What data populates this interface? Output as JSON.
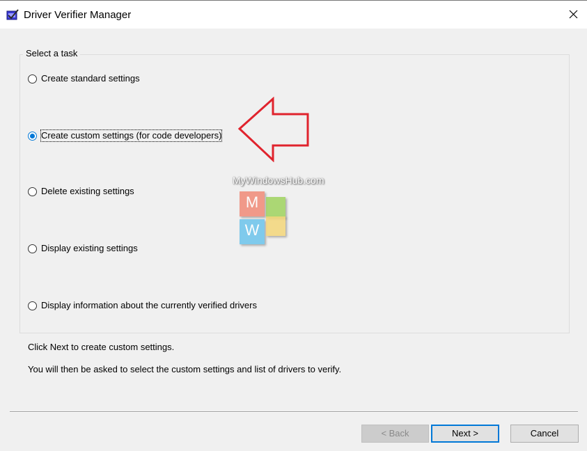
{
  "window": {
    "title": "Driver Verifier Manager"
  },
  "groupbox": {
    "title": "Select a task"
  },
  "options": [
    {
      "label": "Create standard settings",
      "checked": false
    },
    {
      "label": "Create custom settings (for code developers)",
      "checked": true
    },
    {
      "label": "Delete existing settings",
      "checked": false
    },
    {
      "label": "Display existing settings",
      "checked": false
    },
    {
      "label": "Display information about the currently verified drivers",
      "checked": false
    }
  ],
  "info": {
    "line1": "Click Next to create custom settings.",
    "line2": "You will then be asked to select the custom settings and list of drivers to verify."
  },
  "buttons": {
    "back": "< Back",
    "next": "Next >",
    "cancel": "Cancel"
  },
  "watermark": {
    "text": "MyWindowsHub.com",
    "tile_m": "M",
    "tile_w": "W"
  },
  "colors": {
    "accent": "#0078d7",
    "annotation_arrow": "#e0232d",
    "tile_m": "#f08a78",
    "tile_green": "#9fd35f",
    "tile_w": "#6cc4ec",
    "tile_yellow": "#f4d77a"
  },
  "icons": {
    "app": "driver-verifier-icon",
    "close": "close-icon",
    "annotation": "red-arrow-icon"
  }
}
